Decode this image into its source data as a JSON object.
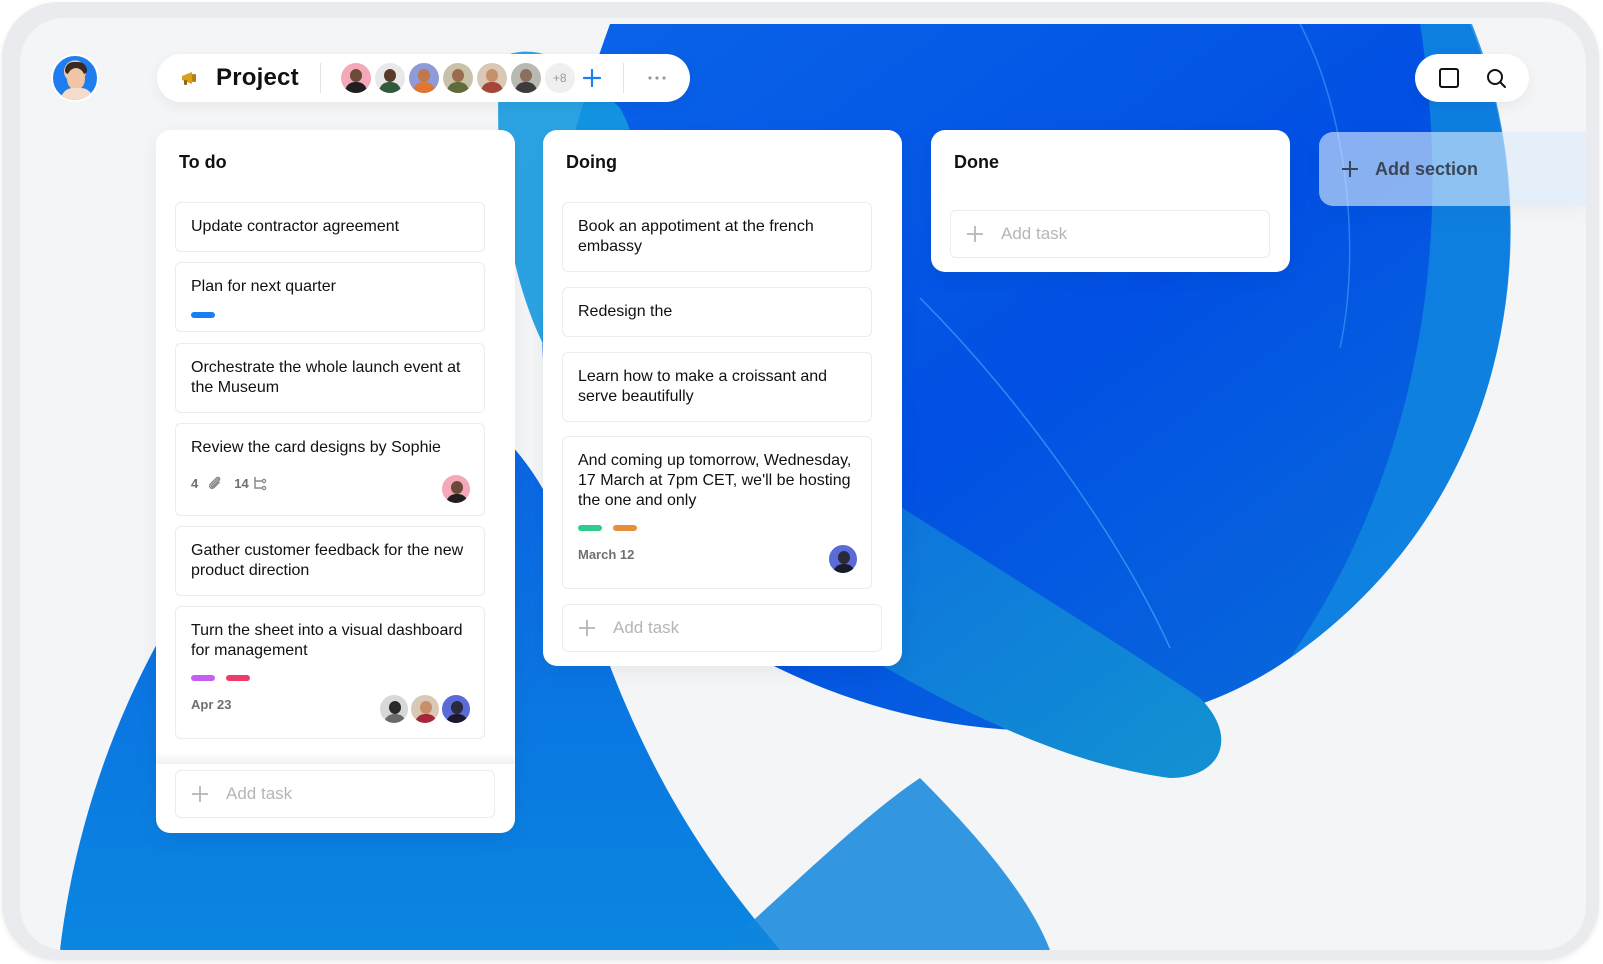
{
  "header": {
    "project_icon": "megaphone-icon",
    "project_title": "Project",
    "members": [
      {
        "name": "member-1",
        "bg": "#f3a9b7",
        "skin": "#6b4a3a",
        "shirt": "#1f1f1f"
      },
      {
        "name": "member-2",
        "bg": "#e8e8e8",
        "skin": "#5a3b2a",
        "shirt": "#2f5b3a"
      },
      {
        "name": "member-3",
        "bg": "#8f9ad8",
        "skin": "#c07a4a",
        "shirt": "#e0762f"
      },
      {
        "name": "member-4",
        "bg": "#c9c1a8",
        "skin": "#9c6b4d",
        "shirt": "#5f6b3a"
      },
      {
        "name": "member-5",
        "bg": "#d9c8b5",
        "skin": "#c8906a",
        "shirt": "#a6463a"
      },
      {
        "name": "member-6",
        "bg": "#b9b9b4",
        "skin": "#8d6e5a",
        "shirt": "#3c3c3c"
      }
    ],
    "more_members": "+8",
    "add_member_icon": "plus-icon",
    "menu_icon": "more-horizontal-icon",
    "tools": {
      "layout_icon": "square-icon",
      "search_icon": "search-icon"
    }
  },
  "colors": {
    "accent": "#1a7ff0",
    "tag_blue": "#1a7ff0",
    "tag_purple": "#c45ff0",
    "tag_pink": "#f03a6a",
    "tag_green": "#2fcb8c",
    "tag_orange": "#e6903a"
  },
  "columns": [
    {
      "title": "To do",
      "cards": [
        {
          "text": "Update contractor agreement"
        },
        {
          "text": "Plan for next quarter",
          "tags": [
            "tag_blue"
          ]
        },
        {
          "text": "Orchestrate the whole launch event at the Museum"
        },
        {
          "text": "Review the card designs by Sophie",
          "attachments": "4",
          "subtasks": "14"
        },
        {
          "text": "Gather customer feedback for the new product direction"
        },
        {
          "text": "Turn the sheet into a visual dashboard for management",
          "tags": [
            "tag_purple",
            "tag_pink"
          ],
          "date": "Apr 23"
        }
      ],
      "add_task_label": "Add task"
    },
    {
      "title": "Doing",
      "cards": [
        {
          "text": "Book an appotiment at the french embassy"
        },
        {
          "text": "Redesign the"
        },
        {
          "text": "Learn how to make a croissant and serve beautifully"
        },
        {
          "text": "And coming up tomorrow, Wednesday, 17 March at 7pm CET, we'll be hosting the one and only",
          "tags": [
            "tag_green",
            "tag_orange"
          ],
          "date": "March 12"
        }
      ],
      "add_task_label": "Add task"
    },
    {
      "title": "Done",
      "cards": [],
      "add_task_label": "Add task"
    }
  ],
  "add_section_label": "Add section"
}
